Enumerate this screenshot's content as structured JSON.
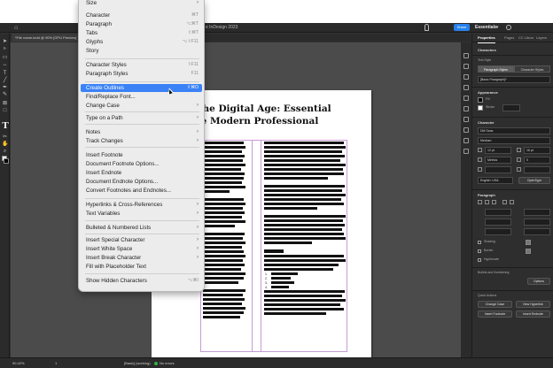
{
  "app": {
    "doc_title": "e InDesign 2023",
    "doc_tab": "*File name.indd @ 90% [GPU Preview]",
    "share_label": "Share",
    "workspace_label": "Essentials",
    "colors": {
      "accent": "#2680eb",
      "selection": "#3a82f6",
      "chrome": "#323232"
    }
  },
  "menu": {
    "items": [
      {
        "label": "Size",
        "shortcut": "",
        "submenu": true
      },
      {
        "label": "Character",
        "shortcut": "⌘T",
        "submenu": false
      },
      {
        "label": "Paragraph",
        "shortcut": "⌥⌘T",
        "submenu": false
      },
      {
        "label": "Tabs",
        "shortcut": "⇧⌘T",
        "submenu": false
      },
      {
        "label": "Glyphs",
        "shortcut": "⌥⇧F11",
        "submenu": false
      },
      {
        "label": "Story",
        "shortcut": "",
        "submenu": false
      },
      {
        "label": "Character Styles",
        "shortcut": "⇧F11",
        "submenu": false
      },
      {
        "label": "Paragraph Styles",
        "shortcut": "F11",
        "submenu": false
      },
      {
        "label": "Create Outlines",
        "shortcut": "⇧⌘O",
        "submenu": false
      },
      {
        "label": "Find/Replace Font...",
        "shortcut": "",
        "submenu": false
      },
      {
        "label": "Change Case",
        "shortcut": "",
        "submenu": true
      },
      {
        "label": "Type on a Path",
        "shortcut": "",
        "submenu": true
      },
      {
        "label": "Notes",
        "shortcut": "",
        "submenu": true
      },
      {
        "label": "Track Changes",
        "shortcut": "",
        "submenu": true
      },
      {
        "label": "Insert Footnote",
        "shortcut": "",
        "submenu": false
      },
      {
        "label": "Document Footnote Options...",
        "shortcut": "",
        "submenu": false
      },
      {
        "label": "Insert Endnote",
        "shortcut": "",
        "submenu": false
      },
      {
        "label": "Document Endnote Options...",
        "shortcut": "",
        "submenu": false
      },
      {
        "label": "Convert Footnotes and Endnotes...",
        "shortcut": "",
        "submenu": false
      },
      {
        "label": "Hyperlinks & Cross-References",
        "shortcut": "",
        "submenu": true
      },
      {
        "label": "Text Variables",
        "shortcut": "",
        "submenu": true
      },
      {
        "label": "Bulleted & Numbered Lists",
        "shortcut": "",
        "submenu": true
      },
      {
        "label": "Insert Special Character",
        "shortcut": "",
        "submenu": true
      },
      {
        "label": "Insert White Space",
        "shortcut": "",
        "submenu": true
      },
      {
        "label": "Insert Break Character",
        "shortcut": "",
        "submenu": true
      },
      {
        "label": "Fill with Placeholder Text",
        "shortcut": "",
        "submenu": false
      },
      {
        "label": "Show Hidden Characters",
        "shortcut": "⌥⌘I",
        "submenu": false
      }
    ]
  },
  "page": {
    "title": "ng the Digital Age: Essential\nr the Modern Professional",
    "list_numbers": [
      "1.",
      "2.",
      "3.",
      "4."
    ]
  },
  "status": {
    "zoom": "90.42%",
    "page": "1",
    "style": "[Basic] (working)",
    "errors": "No errors"
  },
  "panel": {
    "tabs": [
      "Properties",
      "Pages",
      "CC Libraries",
      "Layers"
    ],
    "section_characters": "Characters",
    "text_style_label": "Text Style",
    "text_style_tabs": [
      "Paragraph Styles",
      "Character Styles"
    ],
    "paragraph_style_value": "[Basic Paragraph]+",
    "appearance_label": "Appearance",
    "fill_label": "Fill",
    "stroke_label": "Stroke",
    "character_label": "Character",
    "font_value": "DM Sans",
    "font_style_value": "Medium",
    "size_value": "12 pt",
    "leading_value": "16 pt",
    "kerning_value": "Metrics",
    "tracking_value": "0",
    "language_value": "English: USA",
    "opentype_label": "OpenType",
    "paragraph_label": "Paragraph",
    "shading_label": "Shading",
    "border_label": "Border",
    "hyphenate_label": "Hyphenate",
    "bullets_label": "Bullets and Numbering",
    "options_label": "Options",
    "quick_actions_label": "Quick Actions",
    "quick_actions": [
      "Change Case",
      "New Hyperlink",
      "Insert Footnote",
      "Insert Endnote"
    ]
  }
}
